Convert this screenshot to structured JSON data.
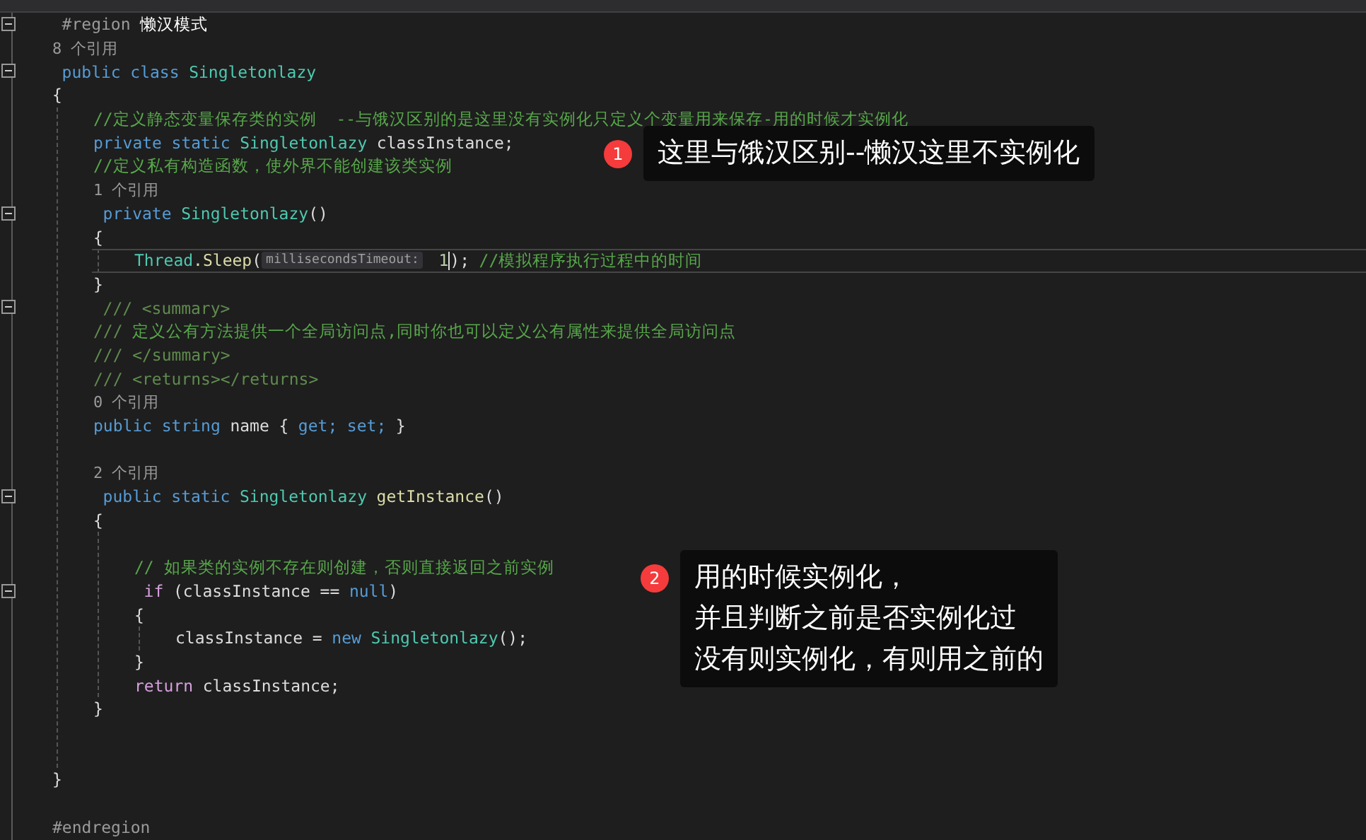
{
  "code_lines": [
    {
      "kind": "code",
      "folded": false,
      "tokens": [
        {
          "kind": "preproc",
          "text": "#region"
        },
        {
          "kind": "region",
          "text": "懒汉模式"
        }
      ]
    },
    {
      "kind": "refs",
      "tokens": [
        {
          "kind": "ref",
          "text": "8 个引用"
        }
      ]
    },
    {
      "kind": "code",
      "folded": false,
      "tokens": [
        {
          "kind": "keyword",
          "text": "public"
        },
        {
          "kind": "keyword",
          "text": "class"
        },
        {
          "kind": "type",
          "text": "Singletonlazy"
        }
      ]
    },
    {
      "kind": "code",
      "tokens": [
        {
          "kind": "plain",
          "text": "{"
        }
      ],
      "children": [
        {
          "kind": "code",
          "tokens": [
            {
              "kind": "comment",
              "text": "//定义静态变量保存类的实例  --与饿汉区别的是这里没有实例化只定义个变量用来保存-用的时候才实例化"
            }
          ]
        },
        {
          "kind": "code",
          "tokens": [
            {
              "kind": "keyword",
              "text": "private"
            },
            {
              "kind": "keyword",
              "text": "static"
            },
            {
              "kind": "type",
              "text": "Singletonlazy"
            },
            {
              "kind": "plain",
              "text": "classInstance;"
            }
          ]
        },
        {
          "kind": "code",
          "tokens": [
            {
              "kind": "comment",
              "text": "//定义私有构造函数，使外界不能创建该类实例"
            }
          ]
        },
        {
          "kind": "refs",
          "tokens": [
            {
              "kind": "ref",
              "text": "1 个引用"
            }
          ]
        },
        {
          "kind": "code",
          "folded": false,
          "tokens": [
            {
              "kind": "keyword",
              "text": "private"
            },
            {
              "kind": "type",
              "text": "Singletonlazy"
            },
            {
              "kind": "plain",
              "text": "()",
              "join": true
            }
          ]
        },
        {
          "kind": "code",
          "tokens": [
            {
              "kind": "plain",
              "text": "{"
            }
          ],
          "children": [
            {
              "kind": "code",
              "current": true,
              "tokens": [
                {
                  "kind": "type",
                  "text": "Thread"
                },
                {
                  "kind": "method",
                  "text": ".Sleep",
                  "join": true
                },
                {
                  "kind": "plain",
                  "text": "(",
                  "join": true
                },
                {
                  "kind": "hint",
                  "text": "millisecondsTimeout:",
                  "join": true
                },
                {
                  "kind": "number",
                  "text": "1"
                },
                {
                  "kind": "plain",
                  "text": ");",
                  "join": true,
                  "caret": true
                },
                {
                  "kind": "comment",
                  "text": "//模拟程序执行过程中的时间"
                }
              ]
            }
          ]
        },
        {
          "kind": "code",
          "tokens": [
            {
              "kind": "plain",
              "text": "}"
            }
          ]
        },
        {
          "kind": "code",
          "folded": false,
          "tokens": [
            {
              "kind": "doc",
              "text": "///"
            },
            {
              "kind": "doctag",
              "text": "<summary>"
            }
          ]
        },
        {
          "kind": "code",
          "tokens": [
            {
              "kind": "doc",
              "text": "///"
            },
            {
              "kind": "comment",
              "text": "定义公有方法提供一个全局访问点,同时你也可以定义公有属性来提供全局访问点"
            }
          ]
        },
        {
          "kind": "code",
          "tokens": [
            {
              "kind": "doc",
              "text": "///"
            },
            {
              "kind": "doctag",
              "text": "</summary>"
            }
          ]
        },
        {
          "kind": "code",
          "tokens": [
            {
              "kind": "doc",
              "text": "///"
            },
            {
              "kind": "doctag",
              "text": "<returns></returns>"
            }
          ]
        },
        {
          "kind": "refs",
          "tokens": [
            {
              "kind": "ref",
              "text": "0 个引用"
            }
          ]
        },
        {
          "kind": "code",
          "tokens": [
            {
              "kind": "keyword",
              "text": "public"
            },
            {
              "kind": "keyword",
              "text": "string"
            },
            {
              "kind": "plain",
              "text": "name"
            },
            {
              "kind": "plain",
              "text": "{"
            },
            {
              "kind": "keyword",
              "text": "get;"
            },
            {
              "kind": "keyword",
              "text": "set;"
            },
            {
              "kind": "plain",
              "text": "}"
            }
          ]
        },
        {
          "kind": "blank"
        },
        {
          "kind": "refs",
          "tokens": [
            {
              "kind": "ref",
              "text": "2 个引用"
            }
          ]
        },
        {
          "kind": "code",
          "folded": false,
          "tokens": [
            {
              "kind": "keyword",
              "text": "public"
            },
            {
              "kind": "keyword",
              "text": "static"
            },
            {
              "kind": "type",
              "text": "Singletonlazy"
            },
            {
              "kind": "method",
              "text": "getInstance"
            },
            {
              "kind": "plain",
              "text": "()",
              "join": true
            }
          ]
        },
        {
          "kind": "code",
          "tokens": [
            {
              "kind": "plain",
              "text": "{"
            }
          ],
          "children": [
            {
              "kind": "blank"
            },
            {
              "kind": "code",
              "tokens": [
                {
                  "kind": "comment",
                  "text": "// 如果类的实例不存在则创建，否则直接返回之前实例"
                }
              ]
            },
            {
              "kind": "code",
              "folded": false,
              "tokens": [
                {
                  "kind": "control",
                  "text": "if"
                },
                {
                  "kind": "plain",
                  "text": "(classInstance =="
                },
                {
                  "kind": "keyword",
                  "text": "null"
                },
                {
                  "kind": "plain",
                  "text": ")",
                  "join": true
                }
              ]
            },
            {
              "kind": "code",
              "tokens": [
                {
                  "kind": "plain",
                  "text": "{"
                }
              ],
              "children": [
                {
                  "kind": "code",
                  "tokens": [
                    {
                      "kind": "plain",
                      "text": "classInstance ="
                    },
                    {
                      "kind": "keyword",
                      "text": "new"
                    },
                    {
                      "kind": "type",
                      "text": "Singletonlazy"
                    },
                    {
                      "kind": "plain",
                      "text": "();",
                      "join": true
                    }
                  ]
                }
              ]
            },
            {
              "kind": "code",
              "tokens": [
                {
                  "kind": "plain",
                  "text": "}"
                }
              ]
            },
            {
              "kind": "code",
              "tokens": [
                {
                  "kind": "control",
                  "text": "return"
                },
                {
                  "kind": "plain",
                  "text": "classInstance;"
                }
              ]
            }
          ]
        },
        {
          "kind": "code",
          "tokens": [
            {
              "kind": "plain",
              "text": "}"
            }
          ]
        },
        {
          "kind": "blank"
        },
        {
          "kind": "blank"
        }
      ]
    },
    {
      "kind": "code",
      "tokens": [
        {
          "kind": "plain",
          "text": "}"
        }
      ]
    },
    {
      "kind": "blank"
    },
    {
      "kind": "code",
      "tokens": [
        {
          "kind": "preproc",
          "text": "#endregion"
        }
      ]
    }
  ],
  "callouts": [
    {
      "number": "1",
      "lines": [
        "这里与饿汉区别--懒汉这里不实例化"
      ]
    },
    {
      "number": "2",
      "lines": [
        "用的时候实例化，",
        "并且判断之前是否实例化过",
        "没有则实例化，有则用之前的"
      ]
    }
  ]
}
